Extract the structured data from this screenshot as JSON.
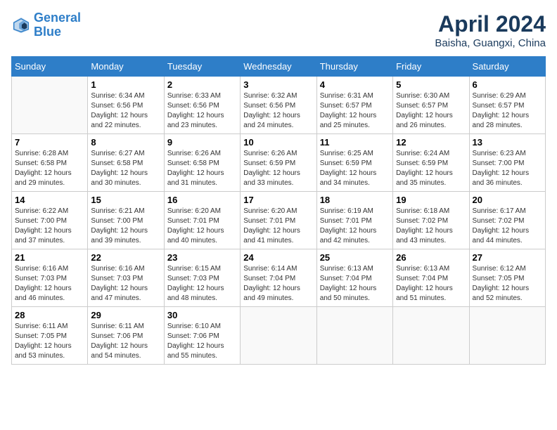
{
  "header": {
    "logo_line1": "General",
    "logo_line2": "Blue",
    "month": "April 2024",
    "location": "Baisha, Guangxi, China"
  },
  "weekdays": [
    "Sunday",
    "Monday",
    "Tuesday",
    "Wednesday",
    "Thursday",
    "Friday",
    "Saturday"
  ],
  "weeks": [
    [
      {
        "num": "",
        "info": ""
      },
      {
        "num": "1",
        "info": "Sunrise: 6:34 AM\nSunset: 6:56 PM\nDaylight: 12 hours\nand 22 minutes."
      },
      {
        "num": "2",
        "info": "Sunrise: 6:33 AM\nSunset: 6:56 PM\nDaylight: 12 hours\nand 23 minutes."
      },
      {
        "num": "3",
        "info": "Sunrise: 6:32 AM\nSunset: 6:56 PM\nDaylight: 12 hours\nand 24 minutes."
      },
      {
        "num": "4",
        "info": "Sunrise: 6:31 AM\nSunset: 6:57 PM\nDaylight: 12 hours\nand 25 minutes."
      },
      {
        "num": "5",
        "info": "Sunrise: 6:30 AM\nSunset: 6:57 PM\nDaylight: 12 hours\nand 26 minutes."
      },
      {
        "num": "6",
        "info": "Sunrise: 6:29 AM\nSunset: 6:57 PM\nDaylight: 12 hours\nand 28 minutes."
      }
    ],
    [
      {
        "num": "7",
        "info": "Sunrise: 6:28 AM\nSunset: 6:58 PM\nDaylight: 12 hours\nand 29 minutes."
      },
      {
        "num": "8",
        "info": "Sunrise: 6:27 AM\nSunset: 6:58 PM\nDaylight: 12 hours\nand 30 minutes."
      },
      {
        "num": "9",
        "info": "Sunrise: 6:26 AM\nSunset: 6:58 PM\nDaylight: 12 hours\nand 31 minutes."
      },
      {
        "num": "10",
        "info": "Sunrise: 6:26 AM\nSunset: 6:59 PM\nDaylight: 12 hours\nand 33 minutes."
      },
      {
        "num": "11",
        "info": "Sunrise: 6:25 AM\nSunset: 6:59 PM\nDaylight: 12 hours\nand 34 minutes."
      },
      {
        "num": "12",
        "info": "Sunrise: 6:24 AM\nSunset: 6:59 PM\nDaylight: 12 hours\nand 35 minutes."
      },
      {
        "num": "13",
        "info": "Sunrise: 6:23 AM\nSunset: 7:00 PM\nDaylight: 12 hours\nand 36 minutes."
      }
    ],
    [
      {
        "num": "14",
        "info": "Sunrise: 6:22 AM\nSunset: 7:00 PM\nDaylight: 12 hours\nand 37 minutes."
      },
      {
        "num": "15",
        "info": "Sunrise: 6:21 AM\nSunset: 7:00 PM\nDaylight: 12 hours\nand 39 minutes."
      },
      {
        "num": "16",
        "info": "Sunrise: 6:20 AM\nSunset: 7:01 PM\nDaylight: 12 hours\nand 40 minutes."
      },
      {
        "num": "17",
        "info": "Sunrise: 6:20 AM\nSunset: 7:01 PM\nDaylight: 12 hours\nand 41 minutes."
      },
      {
        "num": "18",
        "info": "Sunrise: 6:19 AM\nSunset: 7:01 PM\nDaylight: 12 hours\nand 42 minutes."
      },
      {
        "num": "19",
        "info": "Sunrise: 6:18 AM\nSunset: 7:02 PM\nDaylight: 12 hours\nand 43 minutes."
      },
      {
        "num": "20",
        "info": "Sunrise: 6:17 AM\nSunset: 7:02 PM\nDaylight: 12 hours\nand 44 minutes."
      }
    ],
    [
      {
        "num": "21",
        "info": "Sunrise: 6:16 AM\nSunset: 7:03 PM\nDaylight: 12 hours\nand 46 minutes."
      },
      {
        "num": "22",
        "info": "Sunrise: 6:16 AM\nSunset: 7:03 PM\nDaylight: 12 hours\nand 47 minutes."
      },
      {
        "num": "23",
        "info": "Sunrise: 6:15 AM\nSunset: 7:03 PM\nDaylight: 12 hours\nand 48 minutes."
      },
      {
        "num": "24",
        "info": "Sunrise: 6:14 AM\nSunset: 7:04 PM\nDaylight: 12 hours\nand 49 minutes."
      },
      {
        "num": "25",
        "info": "Sunrise: 6:13 AM\nSunset: 7:04 PM\nDaylight: 12 hours\nand 50 minutes."
      },
      {
        "num": "26",
        "info": "Sunrise: 6:13 AM\nSunset: 7:04 PM\nDaylight: 12 hours\nand 51 minutes."
      },
      {
        "num": "27",
        "info": "Sunrise: 6:12 AM\nSunset: 7:05 PM\nDaylight: 12 hours\nand 52 minutes."
      }
    ],
    [
      {
        "num": "28",
        "info": "Sunrise: 6:11 AM\nSunset: 7:05 PM\nDaylight: 12 hours\nand 53 minutes."
      },
      {
        "num": "29",
        "info": "Sunrise: 6:11 AM\nSunset: 7:06 PM\nDaylight: 12 hours\nand 54 minutes."
      },
      {
        "num": "30",
        "info": "Sunrise: 6:10 AM\nSunset: 7:06 PM\nDaylight: 12 hours\nand 55 minutes."
      },
      {
        "num": "",
        "info": ""
      },
      {
        "num": "",
        "info": ""
      },
      {
        "num": "",
        "info": ""
      },
      {
        "num": "",
        "info": ""
      }
    ]
  ]
}
